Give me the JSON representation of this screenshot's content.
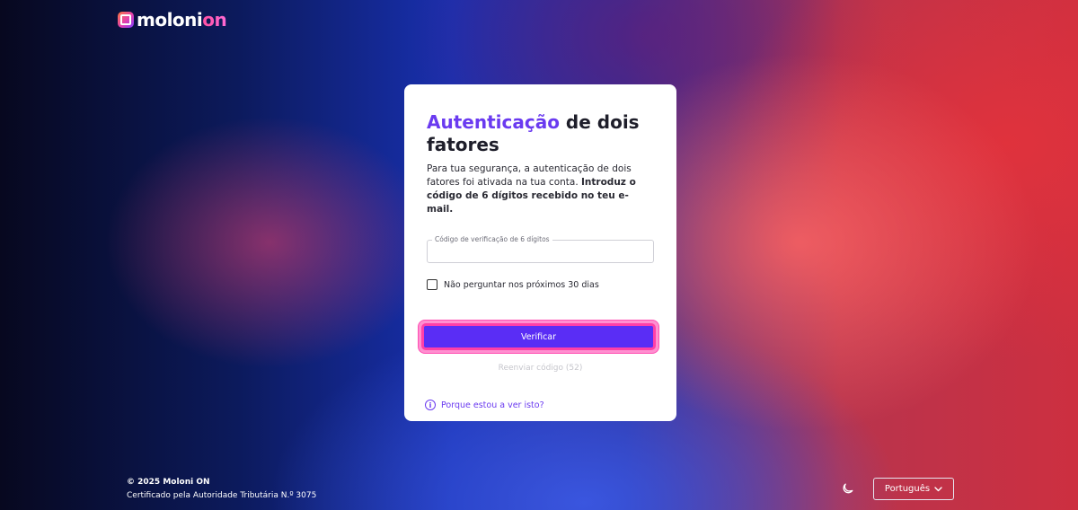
{
  "brand": {
    "name_main": "moloni",
    "name_accent": "on"
  },
  "card": {
    "title_accent": "Autenticação",
    "title_rest": " de dois fatores",
    "description_plain": "Para tua segurança, a autenticação de dois fatores foi ativada na tua conta. ",
    "description_bold": "Introduz o código de 6 dígitos recebido no teu e-mail.",
    "code_field": {
      "label": "Código de verificação de 6 dígitos",
      "value": ""
    },
    "remember_checkbox": {
      "label": "Não perguntar nos próximos 30 dias",
      "checked": false
    },
    "verify_button_label": "Verificar",
    "resend_label": "Reenviar código (52)",
    "why_link_label": "Porque estou a ver isto?"
  },
  "footer": {
    "copyright": "© 2025 Moloni ON",
    "certificate": "Certificado pela Autoridade Tributária N.º 3075",
    "language": "Português"
  },
  "colors": {
    "accent": "#6a3af0",
    "button": "#5a2df5",
    "focus_ring": "#ff3fa8"
  },
  "icons": {
    "logo": "moloni-logo-icon",
    "info": "info-icon",
    "theme": "moon-icon",
    "dropdown": "chevron-down-icon"
  }
}
